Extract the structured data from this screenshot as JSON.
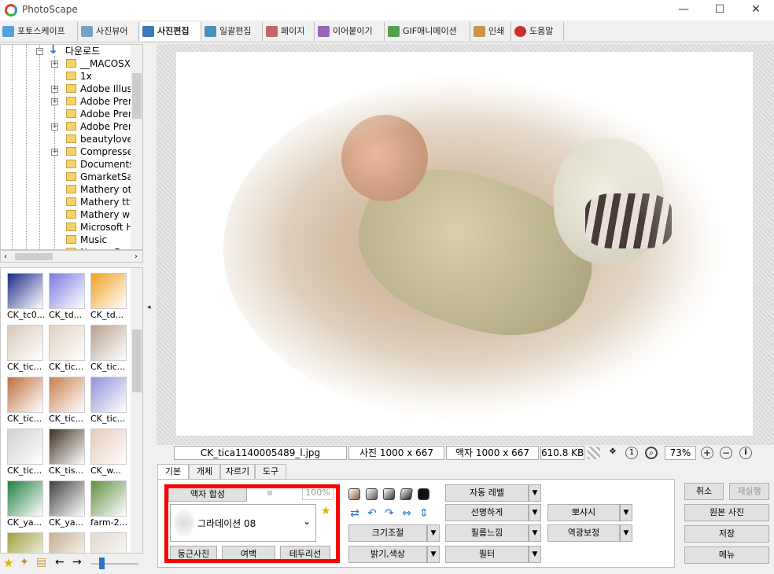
{
  "window": {
    "title": "PhotoScape",
    "minimize": "—",
    "maximize": "☐",
    "close": "✕"
  },
  "tabs": [
    {
      "label": "포토스케이프",
      "color": "#5aa0d8"
    },
    {
      "label": "사진뷰어",
      "color": "#7aa0c0"
    },
    {
      "label": "사진편집",
      "color": "#3a7ab8"
    },
    {
      "label": "일괄편집",
      "color": "#4a90c0"
    },
    {
      "label": "페이지",
      "color": "#c86464"
    },
    {
      "label": "이어붙이기",
      "color": "#9a64b8"
    },
    {
      "label": "GIF애니메이션",
      "color": "#50a050"
    },
    {
      "label": "인쇄",
      "color": "#c8964a"
    },
    {
      "label": "도움말",
      "color": "#d03030"
    }
  ],
  "tree": {
    "root": "다운로드",
    "items": [
      {
        "label": "__MACOSX",
        "expandable": true
      },
      {
        "label": "1x",
        "expandable": false
      },
      {
        "label": "Adobe Illust",
        "expandable": true
      },
      {
        "label": "Adobe Prem",
        "expandable": true
      },
      {
        "label": "Adobe Prem",
        "expandable": false
      },
      {
        "label": "Adobe Prem",
        "expandable": true
      },
      {
        "label": "beautylove-",
        "expandable": false
      },
      {
        "label": "Compressed",
        "expandable": true
      },
      {
        "label": "Documents",
        "expandable": false
      },
      {
        "label": "GmarketSan",
        "expandable": false
      },
      {
        "label": "Mathery otf",
        "expandable": false
      },
      {
        "label": "Mathery ttf",
        "expandable": false
      },
      {
        "label": "Mathery wo",
        "expandable": false
      },
      {
        "label": "Microsoft HE",
        "expandable": false
      },
      {
        "label": "Music",
        "expandable": false
      },
      {
        "label": "NanumFont",
        "expandable": false
      }
    ]
  },
  "thumbnails": [
    {
      "label": "CK_tc0...",
      "color": "#1a2a8a"
    },
    {
      "label": "CK_td...",
      "color": "#7a7ae0"
    },
    {
      "label": "CK_td...",
      "color": "#f0a020"
    },
    {
      "label": "CK_tic...",
      "color": "#d8c8b8"
    },
    {
      "label": "CK_tic...",
      "color": "#e0d0c0"
    },
    {
      "label": "CK_tic...",
      "color": "#b8a090"
    },
    {
      "label": "CK_tic...",
      "color": "#c07040"
    },
    {
      "label": "CK_tic...",
      "color": "#c88050"
    },
    {
      "label": "CK_tic...",
      "color": "#9090d8"
    },
    {
      "label": "CK_tic...",
      "color": "#d0d0d0"
    },
    {
      "label": "CK_tis...",
      "color": "#403020"
    },
    {
      "label": "CK_w...",
      "color": "#e8c8b8"
    },
    {
      "label": "CK_ya...",
      "color": "#208040"
    },
    {
      "label": "CK_ya...",
      "color": "#404040"
    },
    {
      "label": "farm-2...",
      "color": "#609040"
    },
    {
      "label": "",
      "color": "#a0a040"
    },
    {
      "label": "",
      "color": "#c8b090"
    },
    {
      "label": "",
      "color": "#e0d8d0"
    }
  ],
  "status": {
    "filename": "CK_tica1140005489_l.jpg",
    "photo_size": "사진 1000 x 667",
    "frame_size": "액자 1000 x 667",
    "file_size": "610.8 KB",
    "zoom": "73%"
  },
  "panel_tabs": [
    "기본",
    "개체",
    "자르기",
    "도구"
  ],
  "panel": {
    "frame_button": "액자 합성",
    "percent": "100%",
    "frame_select": "그라데이션 08",
    "round_photo": "둥근사진",
    "margin": "여백",
    "border": "테두리선",
    "auto_level": "자동 레벨",
    "sharpen": "선명하게",
    "resize": "크기조절",
    "film": "필름느낌",
    "brightness": "밝기,색상",
    "filter": "필터",
    "bloom": "뽀샤시",
    "backlight": "역광보정"
  },
  "right_buttons": {
    "undo": "취소",
    "redo": "재실행",
    "original": "원본 사진",
    "save": "저장",
    "menu": "메뉴"
  }
}
